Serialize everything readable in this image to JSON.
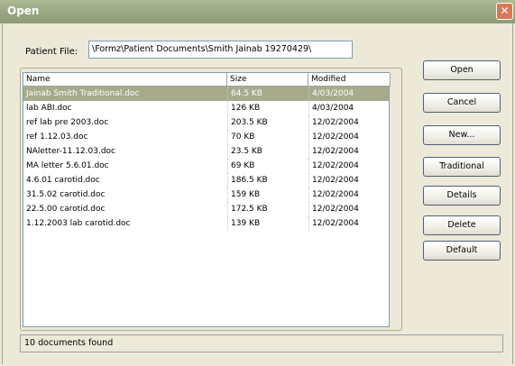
{
  "window": {
    "title": "Open",
    "close_symbol": "✕"
  },
  "patient_file": {
    "label": "Patient File:",
    "value": "\\Formz\\Patient Documents\\Smith Jainab 19270429\\"
  },
  "file_list": {
    "columns": [
      "Name",
      "Size",
      "Modified"
    ],
    "rows": [
      {
        "name": "Jainab Smith Traditional.doc",
        "size": "64.5 KB",
        "modified": "4/03/2004",
        "selected": true
      },
      {
        "name": "lab ABI.doc",
        "size": "126 KB",
        "modified": "4/03/2004",
        "selected": false
      },
      {
        "name": "ref lab pre 2003.doc",
        "size": "203.5 KB",
        "modified": "12/02/2004",
        "selected": false
      },
      {
        "name": "ref 1.12.03.doc",
        "size": "70 KB",
        "modified": "12/02/2004",
        "selected": false
      },
      {
        "name": "NAletter-11.12.03.doc",
        "size": "23.5 KB",
        "modified": "12/02/2004",
        "selected": false
      },
      {
        "name": "MA letter 5.6.01.doc",
        "size": "69 KB",
        "modified": "12/02/2004",
        "selected": false
      },
      {
        "name": "4.6.01 carotid.doc",
        "size": "186.5 KB",
        "modified": "12/02/2004",
        "selected": false
      },
      {
        "name": "31.5.02 carotid.doc",
        "size": "159 KB",
        "modified": "12/02/2004",
        "selected": false
      },
      {
        "name": "22.5.00 carotid.doc",
        "size": "172.5 KB",
        "modified": "12/02/2004",
        "selected": false
      },
      {
        "name": "1.12.2003 lab carotid.doc",
        "size": "139 KB",
        "modified": "12/02/2004",
        "selected": false
      }
    ]
  },
  "buttons": [
    {
      "key": "open",
      "label": "Open"
    },
    {
      "key": "cancel",
      "label": "Cancel"
    },
    {
      "key": "new",
      "label": "New..."
    },
    {
      "key": "traditional",
      "label": "Traditional"
    },
    {
      "key": "details",
      "label": "Details"
    },
    {
      "key": "delete",
      "label": "Delete"
    },
    {
      "key": "default",
      "label": "Default"
    }
  ],
  "status": {
    "text": "10 documents found"
  },
  "colors": {
    "titlebar": "#9aa882",
    "selection": "#a7ab8c",
    "dialog_bg": "#ece9d8"
  }
}
